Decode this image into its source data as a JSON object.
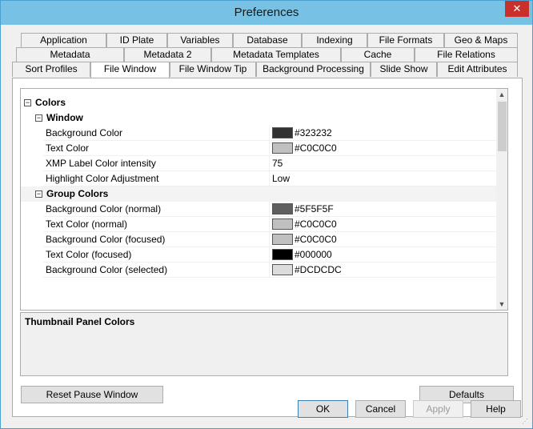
{
  "window": {
    "title": "Preferences",
    "close_glyph": "✕"
  },
  "tabs": {
    "row1": [
      "Application",
      "ID Plate",
      "Variables",
      "Database",
      "Indexing",
      "File Formats",
      "Geo & Maps"
    ],
    "row2": [
      "Metadata",
      "Metadata 2",
      "Metadata Templates",
      "Cache",
      "File Relations"
    ],
    "row3": [
      "Sort Profiles",
      "File Window",
      "File Window Tip",
      "Background Processing",
      "Slide Show",
      "Edit Attributes"
    ],
    "active": "File Window"
  },
  "tree": {
    "expander_glyph": "−",
    "colors_label": "Colors",
    "window_label": "Window",
    "group_colors_label": "Group Colors",
    "window_rows": [
      {
        "name": "Background Color",
        "value": "#323232",
        "swatch": "#323232"
      },
      {
        "name": "Text Color",
        "value": "#C0C0C0",
        "swatch": "#C0C0C0"
      },
      {
        "name": "XMP Label Color intensity",
        "value": "75"
      },
      {
        "name": "Highlight Color Adjustment",
        "value": "Low"
      }
    ],
    "group_rows": [
      {
        "name": "Background Color (normal)",
        "value": "#5F5F5F",
        "swatch": "#5F5F5F"
      },
      {
        "name": "Text Color (normal)",
        "value": "#C0C0C0",
        "swatch": "#C0C0C0"
      },
      {
        "name": "Background Color (focused)",
        "value": "#C0C0C0",
        "swatch": "#C0C0C0"
      },
      {
        "name": "Text Color (focused)",
        "value": "#000000",
        "swatch": "#000000"
      },
      {
        "name": "Background Color (selected)",
        "value": "#DCDCDC",
        "swatch": "#DCDCDC"
      }
    ],
    "scroll_up_glyph": "▲",
    "scroll_down_glyph": "▼"
  },
  "description": {
    "title": "Thumbnail Panel Colors"
  },
  "buttons": {
    "reset_pause": "Reset Pause Window",
    "defaults": "Defaults",
    "ok": "OK",
    "cancel": "Cancel",
    "apply": "Apply",
    "help": "Help"
  }
}
